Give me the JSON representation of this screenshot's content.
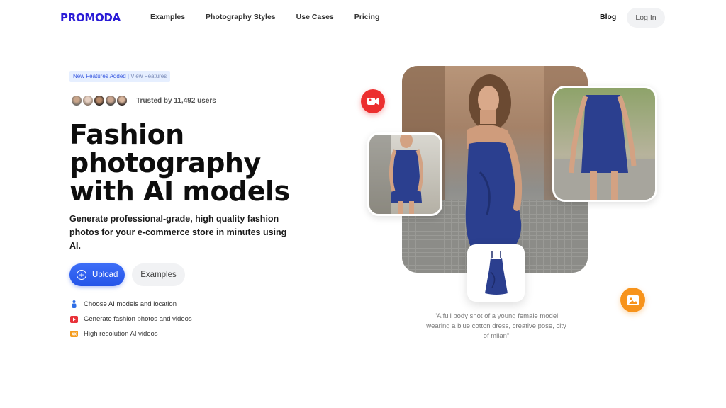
{
  "nav": {
    "logo": "PROMODA",
    "links": [
      "Examples",
      "Photography Styles",
      "Use Cases",
      "Pricing"
    ],
    "blog": "Blog",
    "login": "Log In"
  },
  "hero": {
    "badge_new": "New Features Added",
    "badge_sep": "|",
    "badge_link": "View Features",
    "trusted": "Trusted by 11,492 users",
    "headline": "Fashion photography with AI models",
    "subheadline": "Generate professional-grade, high quality fashion photos for your e-commerce store in minutes using AI.",
    "upload_label": "Upload",
    "upload_icon": "plus-icon",
    "examples_label": "Examples",
    "features": [
      {
        "icon": "person-icon",
        "color": "#2f6ee6",
        "label": "Choose AI models and location"
      },
      {
        "icon": "video-icon",
        "color": "#e8323a",
        "label": "Generate fashion photos and videos"
      },
      {
        "icon": "4k-icon",
        "color": "#f59b1c",
        "label": "High resolution AI videos"
      }
    ]
  },
  "visual": {
    "caption": "\"A full body shot of a young female model wearing a blue cotton dress, creative pose, city of milan\"",
    "rec_icon": "video-camera-icon",
    "image_icon": "image-icon"
  },
  "colors": {
    "brand": "#2a1bd6",
    "primary_button": "#2f5ef0",
    "dress_blue": "#2b3f8f",
    "record_red": "#ec2f2f",
    "image_orange": "#f7931b"
  }
}
